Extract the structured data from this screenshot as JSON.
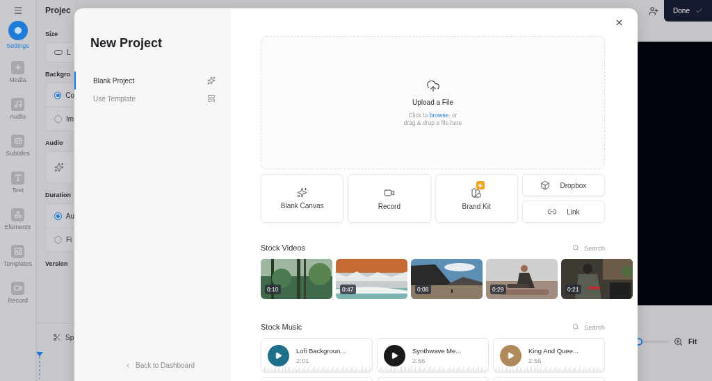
{
  "sidebar": {
    "items": [
      {
        "label": "Settings",
        "kind": "settings",
        "selected": true
      },
      {
        "label": "Media",
        "kind": "plus",
        "selected": false
      },
      {
        "label": "Audio",
        "kind": "note",
        "selected": false
      },
      {
        "label": "Subtitles",
        "kind": "subtitles",
        "selected": false
      },
      {
        "label": "Text",
        "kind": "text",
        "selected": false
      },
      {
        "label": "Elements",
        "kind": "shape",
        "selected": false
      },
      {
        "label": "Templates",
        "kind": "layout",
        "selected": false
      },
      {
        "label": "Record",
        "kind": "camera",
        "selected": false
      }
    ]
  },
  "settings_panel": {
    "title": "Projec",
    "sections": [
      {
        "label": "Size",
        "options": [
          {
            "kind": "select",
            "label": "L"
          }
        ]
      },
      {
        "label": "Backgro",
        "options": [
          {
            "kind": "radio",
            "label": "Co",
            "selected": true
          },
          {
            "kind": "radio",
            "label": "Im",
            "selected": false
          }
        ]
      },
      {
        "label": "Audio",
        "options": [
          {
            "kind": "sparkle"
          }
        ]
      },
      {
        "label": "Duration",
        "options": [
          {
            "kind": "radio",
            "label": "Au",
            "selected": true
          },
          {
            "kind": "radio",
            "label": "Fi",
            "selected": false
          }
        ]
      },
      {
        "label": "Version"
      }
    ],
    "tool": "Sp"
  },
  "top_bar": {
    "done_label": "Done"
  },
  "zoom": {
    "level": 0,
    "fit_label": "Fit"
  },
  "modal": {
    "title": "New Project",
    "menu": [
      {
        "label": "Blank Project",
        "kind": "sparkle",
        "selected": true
      },
      {
        "label": "Use Template",
        "kind": "layout",
        "selected": false
      }
    ],
    "back_label": "Back to Dashboard",
    "upload": {
      "title": "Upload a File",
      "prefix": "Click to",
      "link": "browse",
      "suffix": ", or",
      "line2": "drag & drop a file here"
    },
    "sources": [
      {
        "label": "Blank Canvas",
        "kind": "canvas",
        "premium": false
      },
      {
        "label": "Record",
        "kind": "record",
        "premium": false
      },
      {
        "label": "Brand Kit",
        "kind": "brand",
        "premium": true
      },
      {
        "label": "Dropbox",
        "kind": "dropbox",
        "premium": false
      },
      {
        "label": "Link",
        "kind": "link",
        "premium": false
      }
    ],
    "stock_videos": {
      "title": "Stock Videos",
      "search": "Search",
      "items": [
        {
          "duration": "0:10",
          "kind": "picture"
        },
        {
          "duration": "0:47",
          "kind": "picture"
        },
        {
          "duration": "0:08",
          "kind": "picture"
        },
        {
          "duration": "0:29",
          "kind": "picture"
        },
        {
          "duration": "0:21",
          "kind": "picture"
        }
      ]
    },
    "stock_music": {
      "title": "Stock Music",
      "search": "Search",
      "tracks": [
        {
          "title": "Lofi Backgroun...",
          "duration": "2:01",
          "color": "#1d6f8a"
        },
        {
          "title": "Synthwave Me...",
          "duration": "2:56",
          "color": "#1a1a1a"
        },
        {
          "title": "King And Quee...",
          "duration": "2:56",
          "color": "#b08a5a"
        }
      ]
    }
  }
}
